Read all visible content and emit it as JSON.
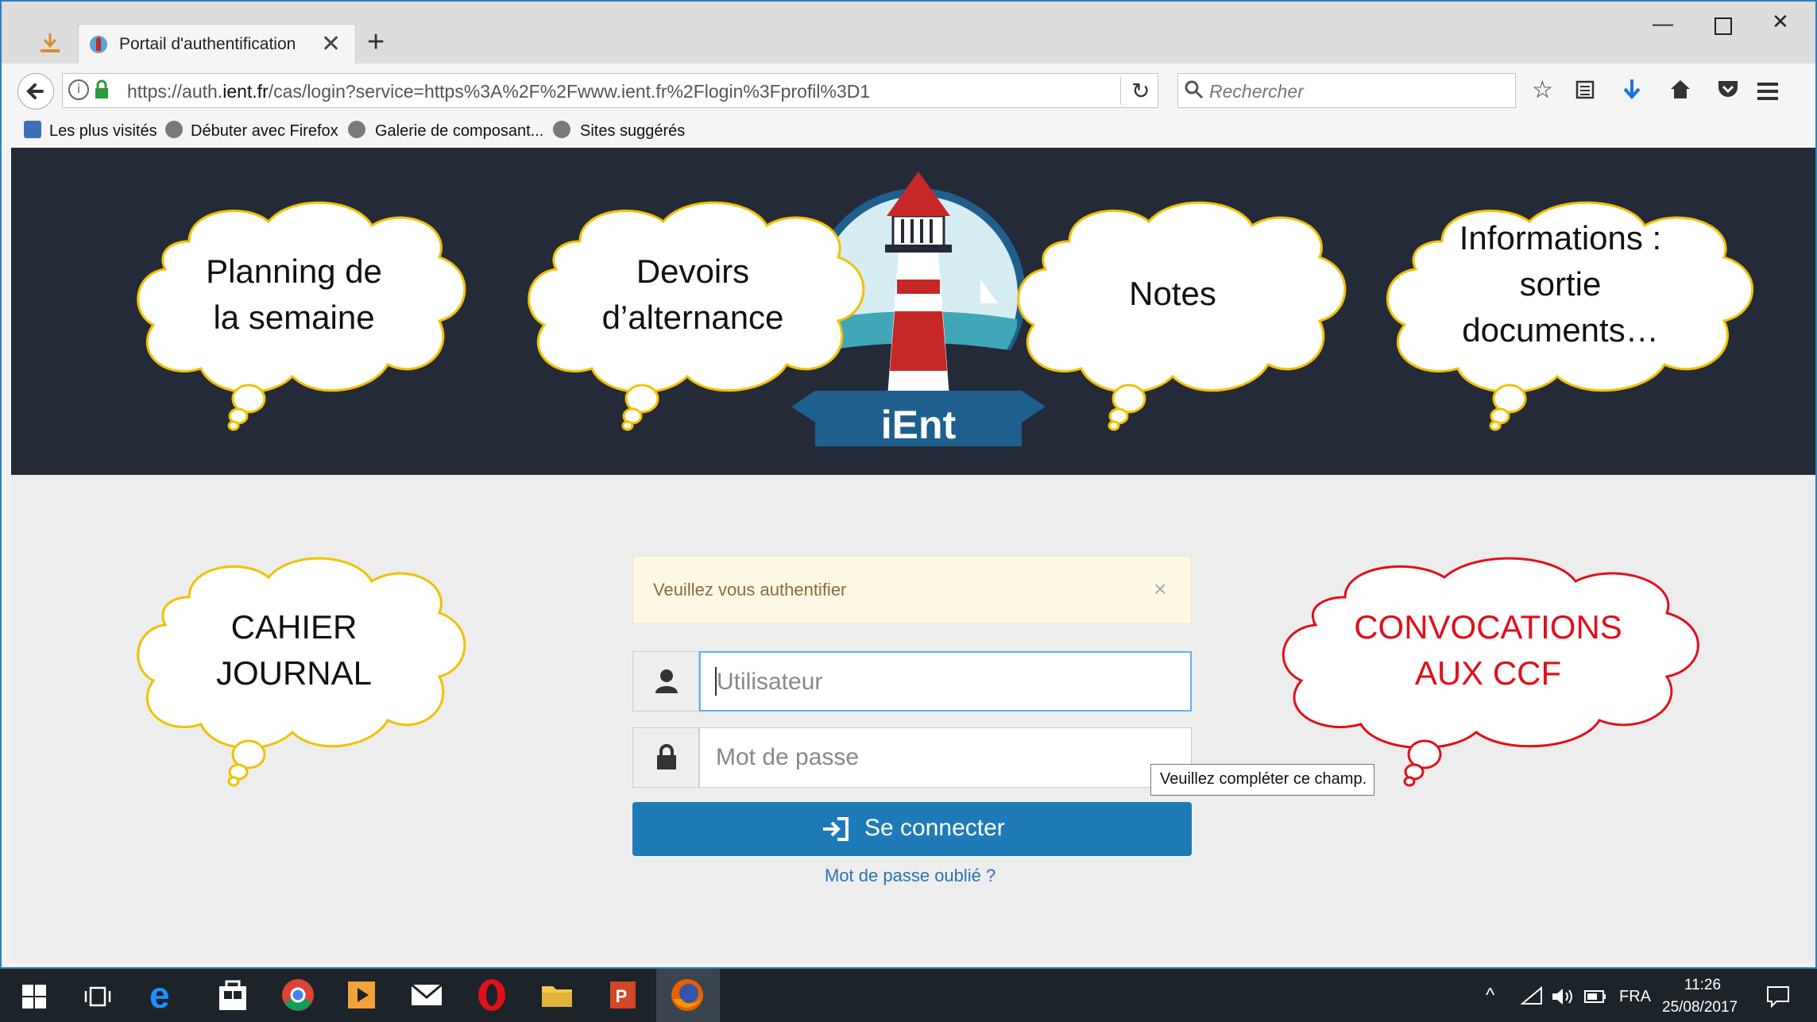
{
  "browser": {
    "tab_title": "Portail d'authentification",
    "new_tab_label": "+",
    "url_prefix": "https://auth.",
    "url_domain": "ient.fr",
    "url_rest": "/cas/login?service=https%3A%2F%2Fwww.ient.fr%2Flogin%3Fprofil%3D1",
    "search_placeholder": "Rechercher",
    "bookmarks": [
      "Les plus visités",
      "Débuter avec Firefox",
      "Galerie de composant...",
      "Sites suggérés"
    ]
  },
  "header": {
    "logo_text": "iEnt"
  },
  "login": {
    "alert_text": "Veuillez vous authentifier",
    "alert_close": "×",
    "username_placeholder": "Utilisateur",
    "password_placeholder": "Mot de passe",
    "submit_label": "Se connecter",
    "forgot_link": "Mot de passe oublié ?",
    "tooltip": "Veuillez compléter ce champ."
  },
  "clouds": {
    "planning": [
      "Planning de",
      "la semaine"
    ],
    "devoirs": [
      "Devoirs",
      "d’alternance"
    ],
    "notes": [
      "Notes"
    ],
    "informations": [
      "Informations :",
      "sortie",
      "documents…"
    ],
    "cahier": [
      "CAHIER",
      "JOURNAL"
    ],
    "convocations": [
      "CONVOCATIONS",
      "AUX CCF"
    ]
  },
  "colors": {
    "header_bg": "#242a38",
    "primary_button": "#1f7ab8",
    "cloud_outline_yellow": "#f2c100",
    "cloud_outline_red": "#e0101a",
    "convocations_text": "#e0101a"
  },
  "taskbar": {
    "language": "FRA",
    "time": "11:26",
    "date": "25/08/2017"
  }
}
